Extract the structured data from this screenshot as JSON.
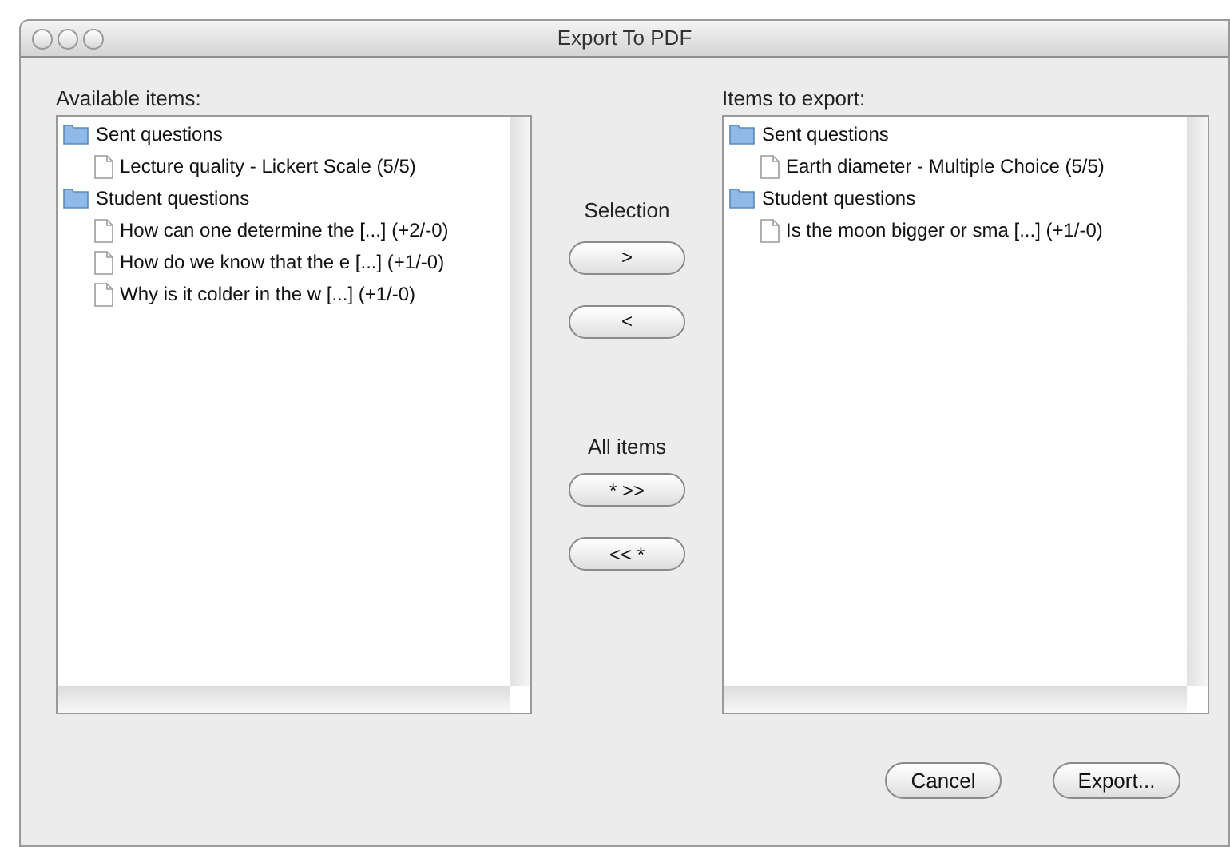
{
  "window": {
    "title": "Export To PDF"
  },
  "available": {
    "label": "Available items:",
    "tree": [
      {
        "label": "Sent questions",
        "children": [
          {
            "label": "Lecture quality - Lickert Scale (5/5)"
          }
        ]
      },
      {
        "label": "Student questions",
        "children": [
          {
            "label": "How can one determine the [...] (+2/-0)"
          },
          {
            "label": "How do we know that the e [...] (+1/-0)"
          },
          {
            "label": "Why is it colder in the w [...] (+1/-0)"
          }
        ]
      }
    ]
  },
  "selection": {
    "label": "Selection",
    "buttons": [
      ">",
      "<"
    ]
  },
  "all_items": {
    "label": "All items",
    "buttons": [
      "* >>",
      "<< *"
    ]
  },
  "to_export": {
    "label": "Items to export:",
    "tree": [
      {
        "label": "Sent questions",
        "children": [
          {
            "label": "Earth diameter - Multiple Choice (5/5)"
          }
        ]
      },
      {
        "label": "Student questions",
        "children": [
          {
            "label": "Is the moon bigger or sma [...] (+1/-0)"
          }
        ]
      }
    ]
  },
  "buttons": [
    "Cancel",
    "Export..."
  ]
}
